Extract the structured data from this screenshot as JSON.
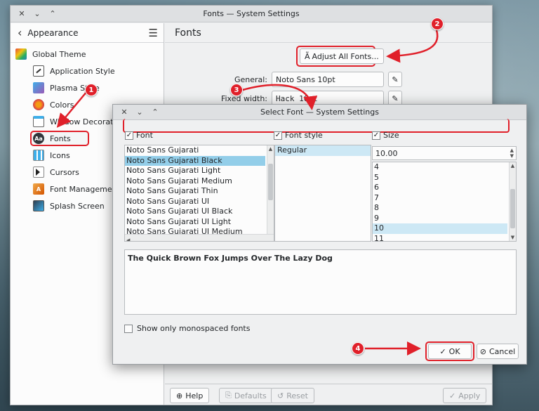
{
  "main_window": {
    "title": "Fonts — System Settings",
    "sidebar": {
      "back_label": "Appearance",
      "items": [
        {
          "label": "Global Theme",
          "icon": "global-theme-icon"
        },
        {
          "label": "Application Style",
          "icon": "application-style-icon"
        },
        {
          "label": "Plasma Style",
          "icon": "plasma-style-icon"
        },
        {
          "label": "Colors",
          "icon": "colors-icon"
        },
        {
          "label": "Window Decorations",
          "icon": "window-decorations-icon"
        },
        {
          "label": "Fonts",
          "icon": "fonts-icon"
        },
        {
          "label": "Icons",
          "icon": "icons-icon"
        },
        {
          "label": "Cursors",
          "icon": "cursors-icon"
        },
        {
          "label": "Font Management",
          "icon": "font-management-icon"
        },
        {
          "label": "Splash Screen",
          "icon": "splash-screen-icon"
        }
      ]
    },
    "content": {
      "heading": "Fonts",
      "adjust_button": "Adjust All Fonts...",
      "rows": [
        {
          "label": "General:",
          "value": "Noto Sans 10pt"
        },
        {
          "label": "Fixed width:",
          "value": "Hack 10pt"
        }
      ]
    },
    "bottom": {
      "help": "Help",
      "defaults": "Defaults",
      "reset": "Reset",
      "apply": "Apply"
    }
  },
  "dialog": {
    "title": "Select Font — System Settings",
    "font_header": "Font",
    "style_header": "Font style",
    "size_header": "Size",
    "fonts": [
      "Noto Sans Gujarati",
      "Noto Sans Gujarati Black",
      "Noto Sans Gujarati Light",
      "Noto Sans Gujarati Medium",
      "Noto Sans Gujarati Thin",
      "Noto Sans Gujarati UI",
      "Noto Sans Gujarati UI Black",
      "Noto Sans Gujarati UI Light",
      "Noto Sans Gujarati UI Medium"
    ],
    "selected_font": "Noto Sans Gujarati Black",
    "styles": [
      "Regular"
    ],
    "size_value": "10.00",
    "sizes": [
      "4",
      "5",
      "6",
      "7",
      "8",
      "9",
      "10",
      "11"
    ],
    "selected_size": "10",
    "preview_text": "The Quick Brown Fox Jumps Over The Lazy Dog",
    "mono_checkbox": "Show only monospaced fonts",
    "ok": "OK",
    "cancel": "Cancel"
  },
  "annotations": [
    "1",
    "2",
    "3",
    "4"
  ],
  "colors": {
    "accent_red": "#e0202a",
    "selection": "#93cee9"
  }
}
